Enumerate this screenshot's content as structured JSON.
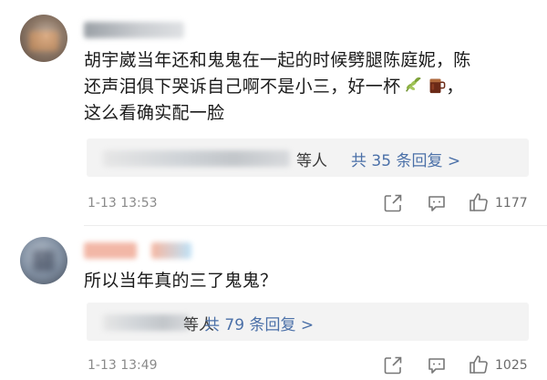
{
  "comments": [
    {
      "username": "",
      "text_lines": [
        "胡宇崴当年还和鬼鬼在一起的时候劈腿陈庭妮，陈",
        "还声泪俱下哭诉自己啊不是小三，好一杯",
        "这么看确实配一脸"
      ],
      "emoji": [
        "green-tea-emoji",
        "black-tea-emoji"
      ],
      "line2_after_emoji": "，",
      "reply_suffix": "等人",
      "reply_count": "共 35 条回复 >",
      "timestamp": "1-13 13:53",
      "likes": "1177"
    },
    {
      "username": "",
      "text_lines": [
        "所以当年真的三了鬼鬼？"
      ],
      "reply_suffix": "等人",
      "reply_count": "共 79 条回复 >",
      "timestamp": "1-13 13:49",
      "likes": "1025"
    }
  ],
  "colors": {
    "text": "#1a1a1a",
    "link_blue": "#4b70a8",
    "meta_gray": "#8a8a8a",
    "reply_bg": "#f3f3f3"
  },
  "icons": [
    "share-icon",
    "comment-icon",
    "like-icon"
  ]
}
